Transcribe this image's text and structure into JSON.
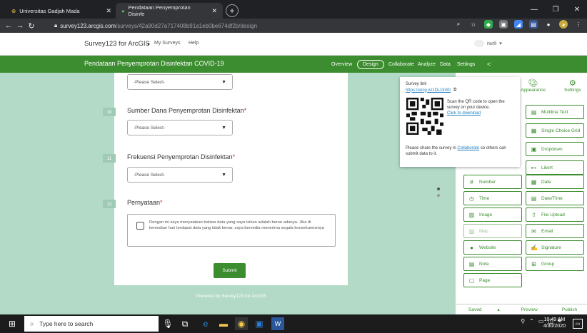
{
  "browser": {
    "tabs": [
      {
        "label": "Universitas Gadjah Mada"
      },
      {
        "label": "Pendataan Penyemprotan Disinfe"
      }
    ],
    "url_domain": "survey123.arcgis.com",
    "url_path": "/surveys/42a90d27a717408b91a1eb0be674df2b/design"
  },
  "app": {
    "brand": "Survey123 for ArcGIS",
    "my_surveys": "My Surveys",
    "help": "Help",
    "user": "nurli"
  },
  "survey_nav": {
    "title": "Pendataan Penyemprotan Disinfektan COVID-19",
    "items": [
      "Overview",
      "Design",
      "Collaborate",
      "Analyze",
      "Data",
      "Settings"
    ]
  },
  "form": {
    "select_placeholder": "-Please Select-",
    "q10": {
      "num": "10",
      "label": "Sumber Dana Penyemprotan Disinfektan"
    },
    "q11": {
      "num": "11",
      "label": "Frekuensi Penyemprotan Disinfektan"
    },
    "q12": {
      "num": "12",
      "label": "Pernyataan"
    },
    "required_mark": "*",
    "agreement": "Dengan ini saya menyatakan bahwa data yang saya isikan adalah benar adanya. Jika di kemudian hari terdapat data yang tidak benar, saya bersedia menerima segala konsekuensinya",
    "submit": "Submit",
    "powered": "Powered by Survey123 for ArcGIS"
  },
  "popup": {
    "title": "Survey link",
    "link": "https://arcg.is/1DLOn90",
    "qr_text": "Scan the QR code to open the survey on your device.",
    "download": "Click to download",
    "share_pre": "Please share the survey in",
    "share_link": "Collaborate",
    "share_post": "so others can submit data to it."
  },
  "panel": {
    "tabs": [
      "Appearance",
      "Settings"
    ],
    "question_types": [
      {
        "label": "Multiline Text",
        "icon": "multiline-icon"
      },
      {
        "label": "Single Choice Grid",
        "icon": "grid-icon"
      },
      {
        "label": "Dropdown",
        "icon": "dropdown-icon"
      },
      {
        "label": "Likert",
        "icon": "likert-icon"
      },
      {
        "label": "Number",
        "icon": "number-icon"
      },
      {
        "label": "Date",
        "icon": "date-icon"
      },
      {
        "label": "Time",
        "icon": "time-icon"
      },
      {
        "label": "Date/Time",
        "icon": "datetime-icon"
      },
      {
        "label": "Image",
        "icon": "image-icon"
      },
      {
        "label": "File Upload",
        "icon": "upload-icon"
      },
      {
        "label": "Map",
        "icon": "map-icon"
      },
      {
        "label": "Email",
        "icon": "email-icon"
      },
      {
        "label": "Website",
        "icon": "globe-icon"
      },
      {
        "label": "Signature",
        "icon": "signature-icon"
      },
      {
        "label": "Note",
        "icon": "note-icon"
      },
      {
        "label": "Group",
        "icon": "group-icon"
      },
      {
        "label": "Page",
        "icon": "page-icon"
      }
    ],
    "footer": {
      "saved": "Saved",
      "preview": "Preview",
      "publish": "Publish"
    }
  },
  "taskbar": {
    "search_placeholder": "Type here to search",
    "time": "10:49 AM",
    "date": "4/30/2020"
  },
  "colors": {
    "brand_green": "#3c8d2f",
    "canvas": "#b2dac7"
  }
}
